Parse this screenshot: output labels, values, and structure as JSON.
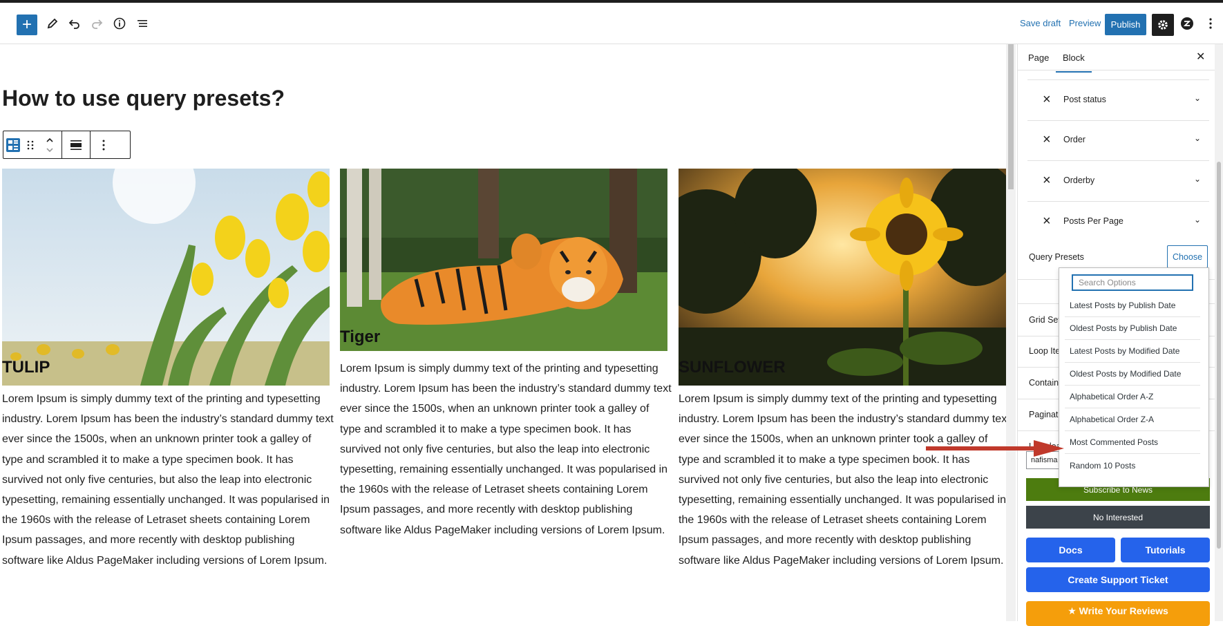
{
  "topbar": {
    "save_draft": "Save draft",
    "preview": "Preview",
    "publish": "Publish"
  },
  "canvas": {
    "page_title": "How to use query presets?",
    "posts": [
      {
        "title": "TULIP",
        "body": "Lorem Ipsum is simply dummy text of the printing and typesetting industry. Lorem Ipsum has been the industry’s standard dummy text ever since the 1500s, when an unknown printer took a galley of type and scrambled it to make a type specimen book. It has survived not only five centuries, but also the leap into electronic typesetting, remaining essentially unchanged. It was popularised in the 1960s with the release of Letraset sheets containing Lorem Ipsum passages, and more recently with desktop publishing software like Aldus PageMaker including versions of Lorem Ipsum."
      },
      {
        "title": "Tiger",
        "body": "Lorem Ipsum is simply dummy text of the printing and typesetting industry. Lorem Ipsum has been the industry’s standard dummy text ever since the 1500s, when an unknown printer took a galley of type and scrambled it to make a type specimen book. It has survived not only five centuries, but also the leap into electronic typesetting, remaining essentially unchanged. It was popularised in the 1960s with the release of Letraset sheets containing Lorem Ipsum passages, and more recently with desktop publishing software like Aldus PageMaker including versions of Lorem Ipsum."
      },
      {
        "title": "SUNFLOWER",
        "body": "Lorem Ipsum is simply dummy text of the printing and typesetting industry. Lorem Ipsum has been the industry’s standard dummy text ever since the 1500s, when an unknown printer took a galley of type and scrambled it to make a type specimen book. It has survived not only five centuries, but also the leap into electronic typesetting, remaining essentially unchanged. It was popularised in the 1960s with the release of Letraset sheets containing Lorem Ipsum passages, and more recently with desktop publishing software like Aldus PageMaker including versions of Lorem Ipsum."
      }
    ]
  },
  "sidebar": {
    "tabs": [
      "Page",
      "Block"
    ],
    "active_tab": "Block",
    "filters": [
      "Post status",
      "Order",
      "Orderby",
      "Posts Per Page"
    ],
    "query_presets_label": "Query Presets",
    "choose_label": "Choose",
    "sections": [
      "Grid Set",
      "Loop Ite",
      "Contain",
      "Paginati",
      "Lazy loa"
    ],
    "partial_input_value": "nafisma",
    "subscribe_label": "Subscribe to News",
    "not_interested_label": "No Interested",
    "docs_label": "Docs",
    "tutorials_label": "Tutorials",
    "support_label": "Create Support Ticket",
    "review_label": "Write Your Reviews"
  },
  "dropdown": {
    "search_placeholder": "Search Options",
    "options": [
      "Latest Posts by Publish Date",
      "Oldest Posts by Publish Date",
      "Latest Posts by Modified Date",
      "Oldest Posts by Modified Date",
      "Alphabetical Order A-Z",
      "Alphabetical Order Z-A",
      "Most Commented Posts",
      "Random 10 Posts"
    ],
    "highlighted_option": "Most Commented Posts"
  },
  "colors": {
    "accent": "#2271b1",
    "subscribe_green": "#4d7c0f",
    "dark_button": "#3c434a",
    "cta_blue": "#2563eb",
    "review_orange": "#f59e0b",
    "arrow_red": "#c0392b"
  },
  "icons": [
    "plus-icon",
    "pencil-icon",
    "undo-icon",
    "redo-icon",
    "info-icon",
    "list-view-icon",
    "gear-icon",
    "plugin-logo-icon",
    "kebab-menu-icon",
    "close-icon",
    "chevron-down-icon"
  ]
}
